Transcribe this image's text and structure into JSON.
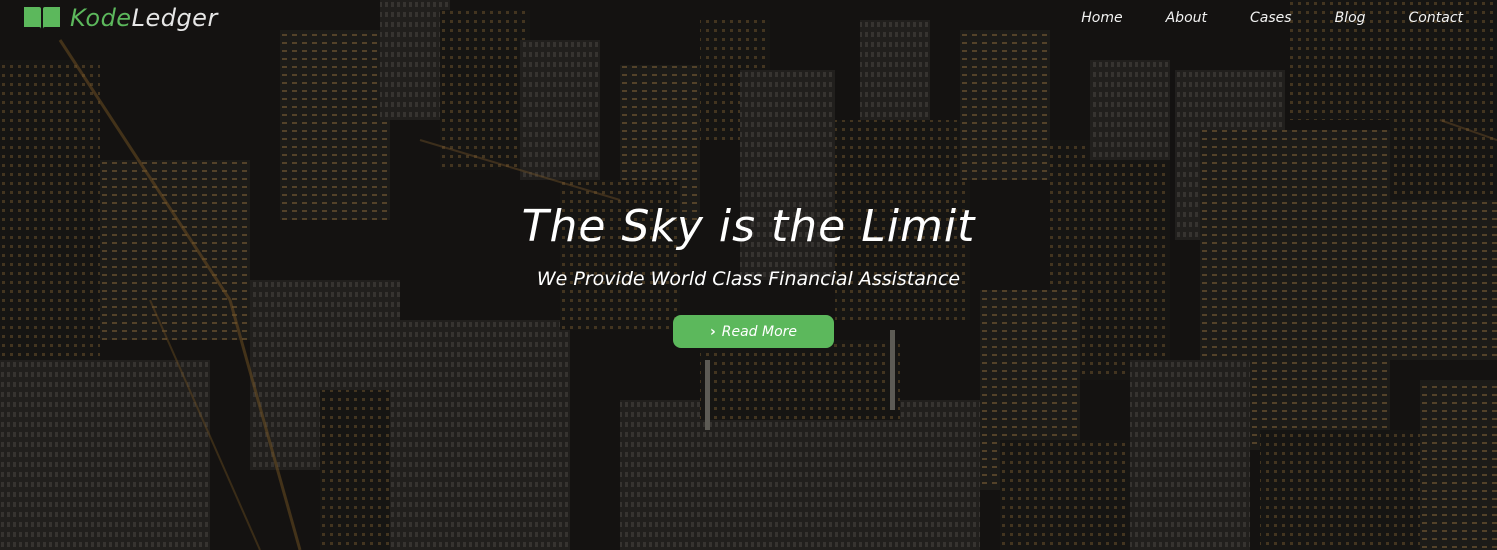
{
  "brand": {
    "name_part1": "Kode",
    "name_part2": "Ledger",
    "icon": "book-icon",
    "accent_color": "#5cb85c"
  },
  "nav": {
    "items": [
      {
        "label": "Home"
      },
      {
        "label": "About"
      },
      {
        "label": "Cases"
      },
      {
        "label": "Blog"
      },
      {
        "label": "Contact"
      }
    ]
  },
  "hero": {
    "background": "night city skyline aerial photo",
    "title": "The Sky is the Limit",
    "subtitle": "We Provide World Class Financial Assistance",
    "cta": {
      "label": "Read More",
      "icon": "chevron-right-icon",
      "color": "#5cb85c"
    }
  }
}
